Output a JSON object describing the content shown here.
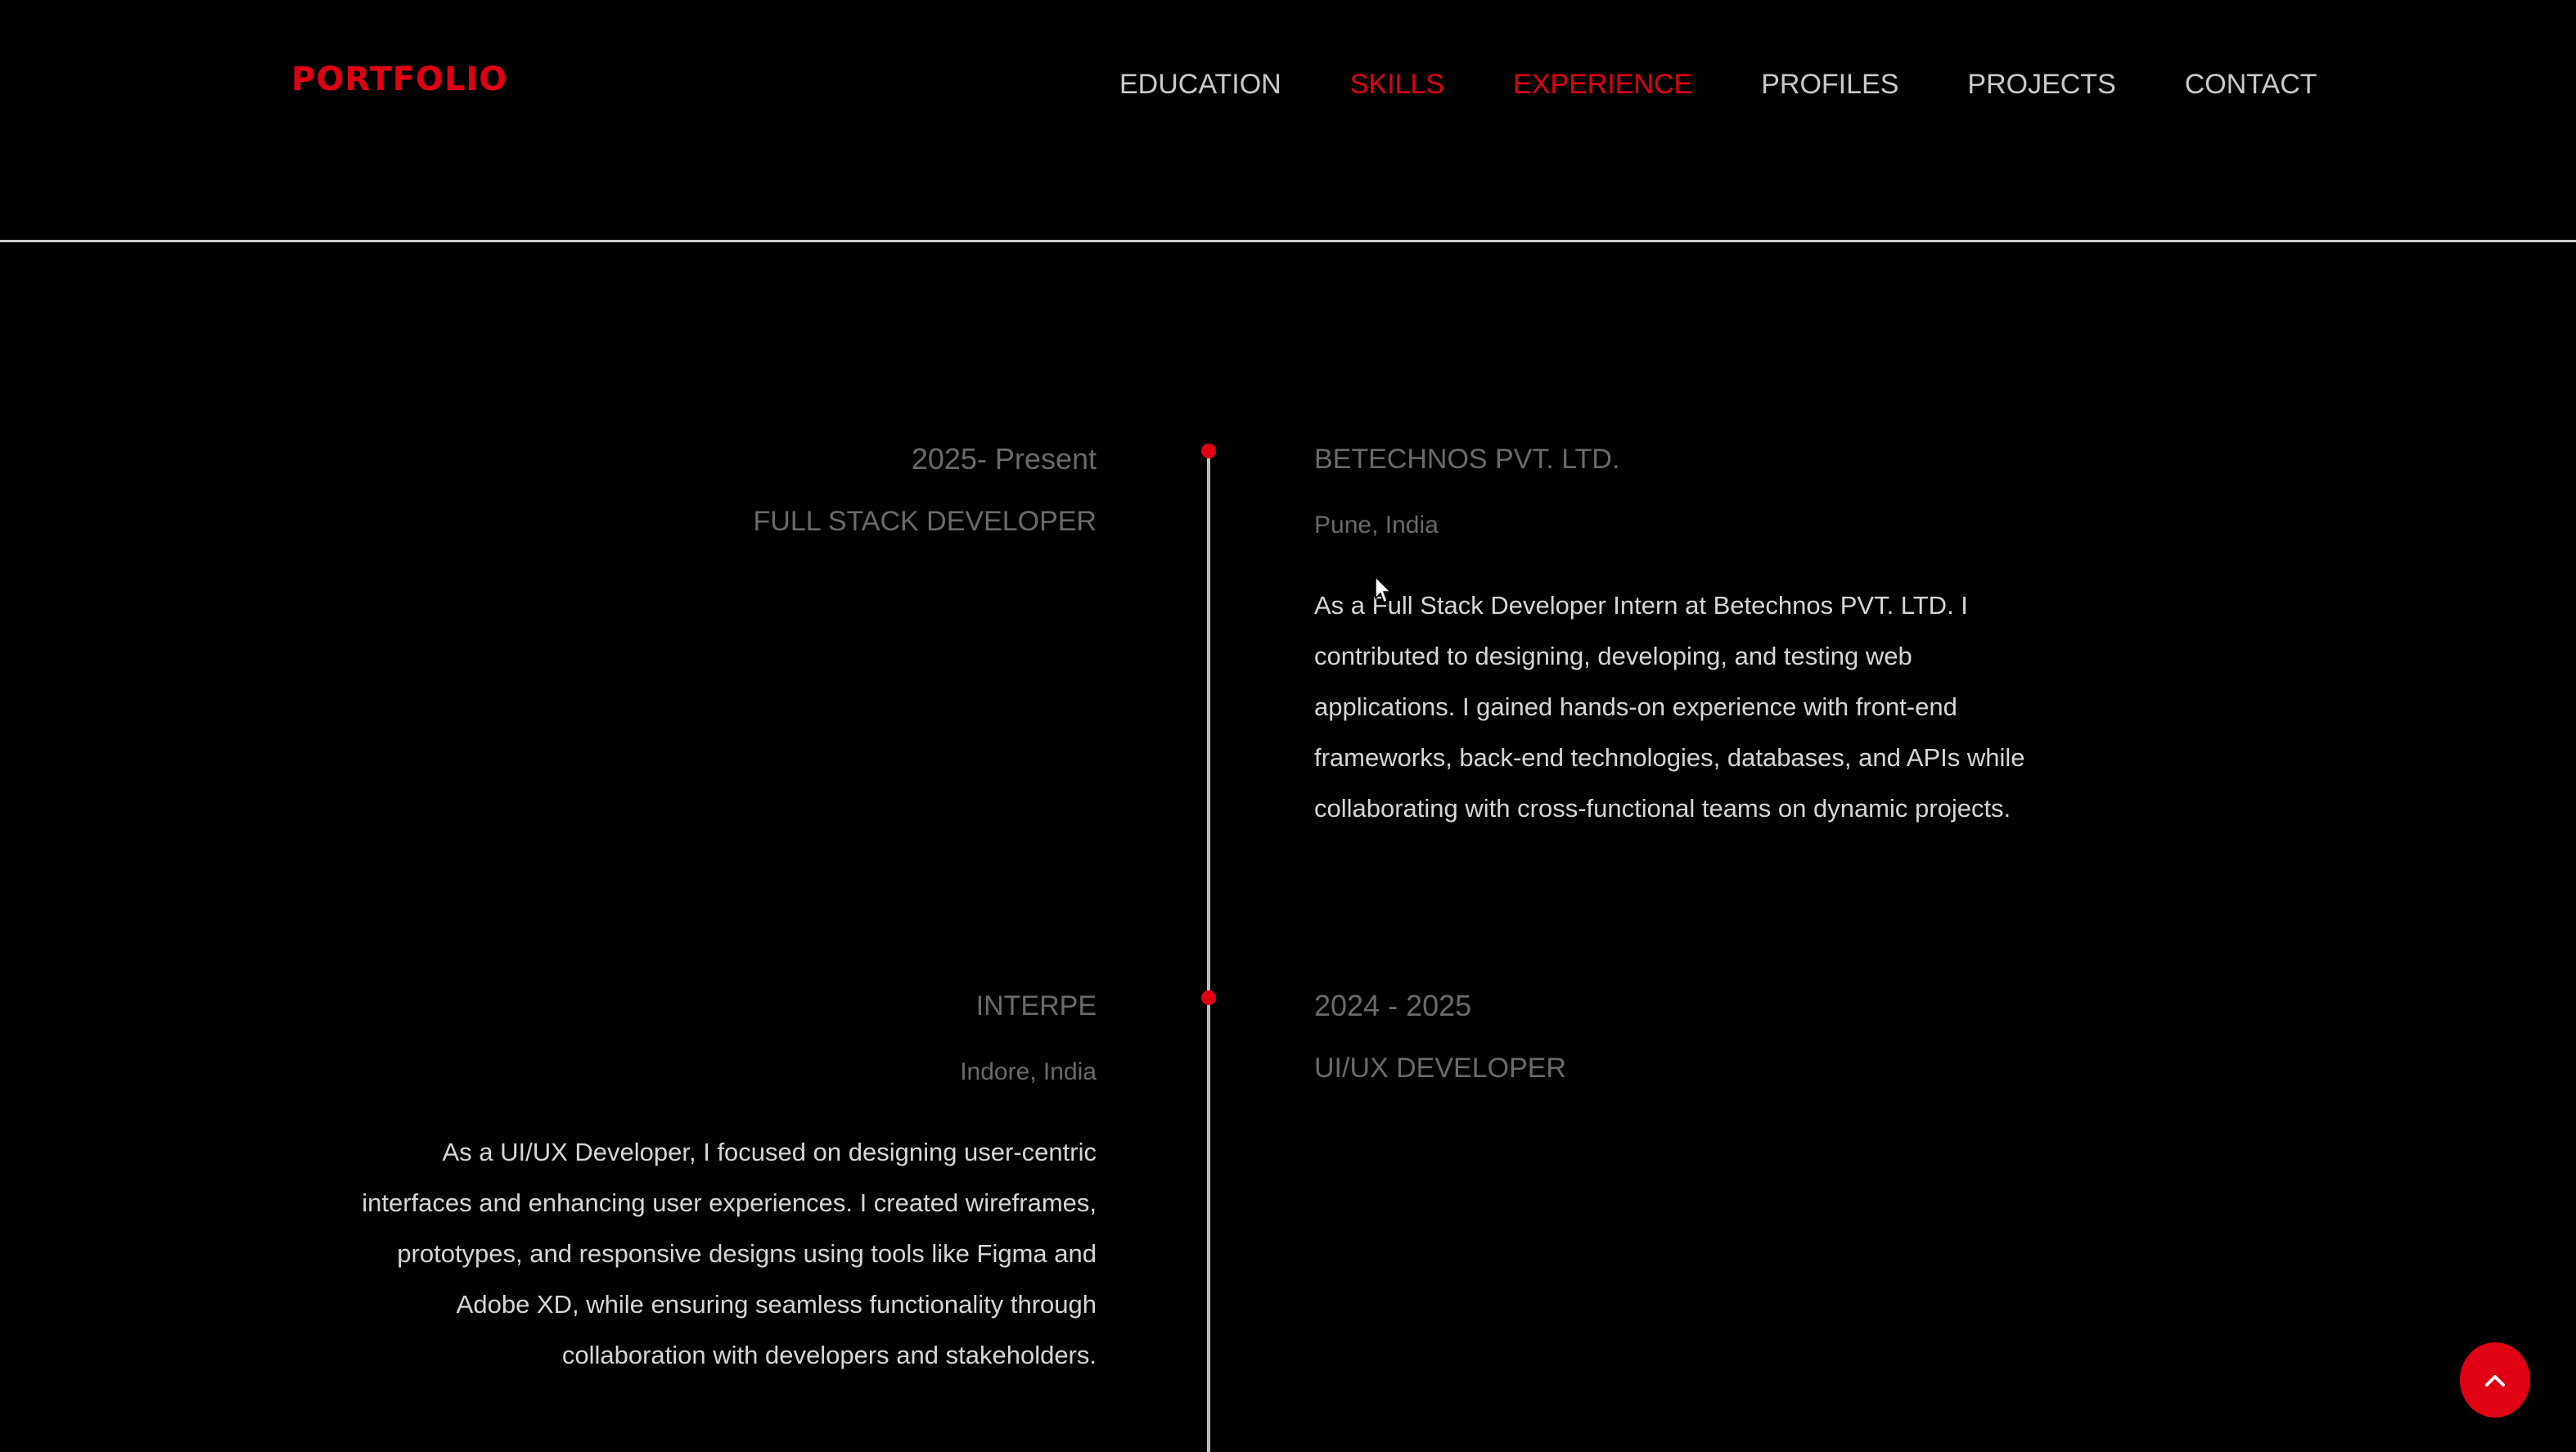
{
  "header": {
    "logo": "PORTFOLIO",
    "nav": [
      {
        "label": "EDUCATION",
        "active": false
      },
      {
        "label": "SKILLS",
        "active": true
      },
      {
        "label": "EXPERIENCE",
        "active": true
      },
      {
        "label": "PROFILES",
        "active": false
      },
      {
        "label": "PROJECTS",
        "active": false
      },
      {
        "label": "CONTACT",
        "active": false
      }
    ]
  },
  "experience": [
    {
      "date": "2025- Present",
      "role": "FULL STACK DEVELOPER",
      "company": "BETECHNOS PVT. LTD.",
      "location": "Pune, India",
      "description": [
        "As a Full Stack Developer Intern at Betechnos PVT. LTD. I",
        "contributed to designing, developing, and testing web",
        "applications. I gained hands-on experience with front-end",
        "frameworks, back-end technologies, databases, and APIs while",
        "collaborating with cross-functional teams on dynamic projects."
      ]
    },
    {
      "date": "2024 - 2025",
      "role": "UI/UX DEVELOPER",
      "company": "INTERPE",
      "location": "Indore, India",
      "description": [
        "As a UI/UX Developer, I focused on designing user-centric",
        "interfaces and enhancing user experiences. I created wireframes,",
        "prototypes, and responsive designs using tools like Figma and",
        "Adobe XD, while ensuring seamless functionality through",
        "collaboration with developers and stakeholders."
      ]
    }
  ],
  "colors": {
    "accent": "#e00012",
    "background": "#000000",
    "muted_text": "#6a6a6a",
    "body_text": "#d6d6d6",
    "nav_text": "#c9c9c9"
  },
  "icons": {
    "back_to_top": "chevron-up-icon",
    "cursor": "mouse-pointer-icon"
  }
}
